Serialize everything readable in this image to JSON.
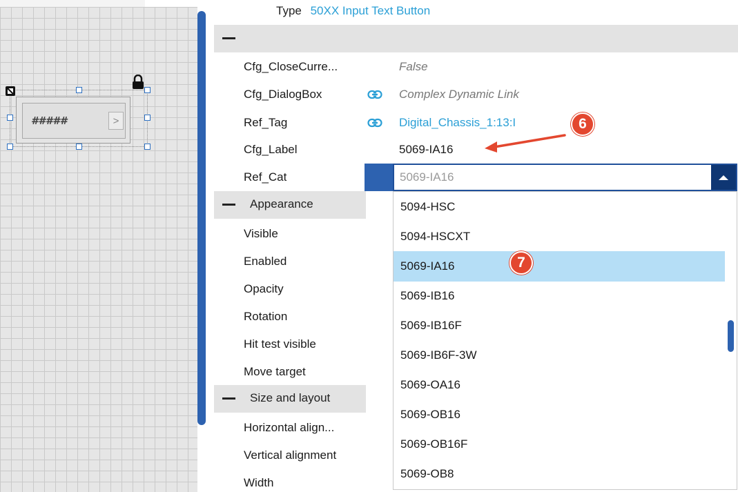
{
  "canvas": {
    "widget_text": "#####"
  },
  "header": {
    "type_label": "Type",
    "type_value": "50XX Input Text Button"
  },
  "properties": [
    {
      "label": "Cfg_CloseCurre...",
      "value": "False",
      "style": "gray",
      "linked": false
    },
    {
      "label": "Cfg_DialogBox",
      "value": "Complex Dynamic Link",
      "style": "gray",
      "linked": true
    },
    {
      "label": "Ref_Tag",
      "value": "Digital_Chassis_1:13:I",
      "style": "link",
      "linked": true
    },
    {
      "label": "Cfg_Label",
      "value": "5069-IA16",
      "style": "dark",
      "linked": false
    },
    {
      "label": "Ref_Cat",
      "value": "",
      "style": "dark",
      "linked": false
    }
  ],
  "ref_cat_combo": {
    "value": "5069-IA16"
  },
  "sections": {
    "appearance": "Appearance",
    "size_layout": "Size and layout"
  },
  "appearance_props": [
    "Visible",
    "Enabled",
    "Opacity",
    "Rotation",
    "Hit test visible",
    "Move target"
  ],
  "layout_props": [
    "Horizontal align...",
    "Vertical alignment",
    "Width"
  ],
  "dropdown": {
    "items": [
      "5094-HSC",
      "5094-HSCXT",
      "5069-IA16",
      "5069-IB16",
      "5069-IB16F",
      "5069-IB6F-3W",
      "5069-OA16",
      "5069-OB16",
      "5069-OB16F",
      "5069-OB8"
    ],
    "selected": "5069-IA16"
  },
  "annotations": {
    "step6": "6",
    "step7": "7"
  },
  "colors": {
    "accent": "#2d62b0",
    "link": "#2a9fd6",
    "selected": "#b5def6",
    "badge": "#e3472f"
  }
}
